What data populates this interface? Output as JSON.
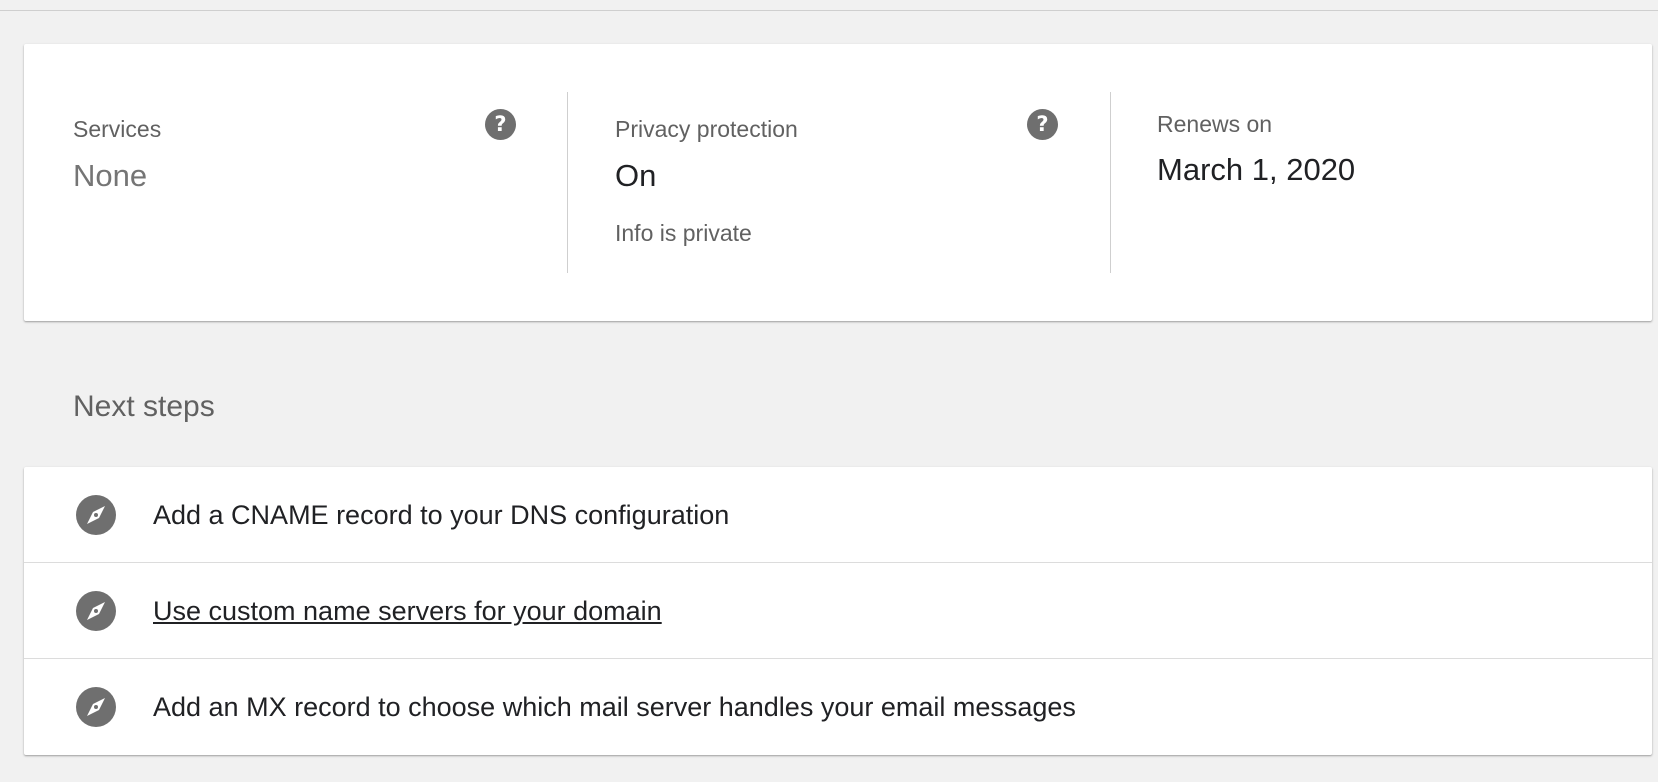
{
  "summary": {
    "services": {
      "label": "Services",
      "value": "None",
      "help_icon": "help-icon"
    },
    "privacy": {
      "label": "Privacy protection",
      "value": "On",
      "sub": "Info is private",
      "help_icon": "help-icon"
    },
    "renews": {
      "label": "Renews on",
      "value": "March 1, 2020"
    }
  },
  "next_steps": {
    "title": "Next steps",
    "icon": "compass-icon",
    "items": [
      {
        "label": "Add a CNAME record to your DNS configuration"
      },
      {
        "label": "Use custom name servers for your domain"
      },
      {
        "label": "Add an MX record to choose which mail server handles your email messages"
      }
    ]
  },
  "colors": {
    "background": "#f1f1f1",
    "card": "#ffffff",
    "label_gray": "#616161",
    "value_muted": "#757575",
    "value_dark": "#202124",
    "icon_gray": "#6f6f6f",
    "divider": "#cfcfcf"
  }
}
